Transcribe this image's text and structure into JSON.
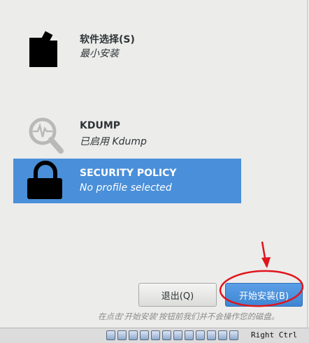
{
  "spokes": [
    {
      "title": "软件选择(S)",
      "status": "最小安装",
      "icon": "package-icon"
    },
    {
      "title": "KDUMP",
      "status": "已启用 Kdump",
      "icon": "magnifier-icon"
    },
    {
      "title": "SECURITY POLICY",
      "status": "No profile selected",
      "icon": "lock-icon",
      "selected": true
    }
  ],
  "buttons": {
    "quit_label": "退出(Q)",
    "begin_label": "开始安装(B)"
  },
  "hint": "在点击'开始安装'按钮前我们并不会操作您的磁盘。",
  "vm_status": {
    "icons": [
      "hard-disk-icon",
      "optical-drive-icon",
      "audio-icon",
      "network-icon",
      "usb-icon",
      "pencil-icon",
      "shared-folder-icon",
      "display-icon",
      "video-capture-icon",
      "cpu-icon",
      "mouse-icon",
      "arrow-down-icon"
    ],
    "host_key": "Right Ctrl"
  },
  "colors": {
    "selected_spoke": "#4a8fd9",
    "primary_button": "#3f86d3",
    "annotation": "#e0151b"
  }
}
